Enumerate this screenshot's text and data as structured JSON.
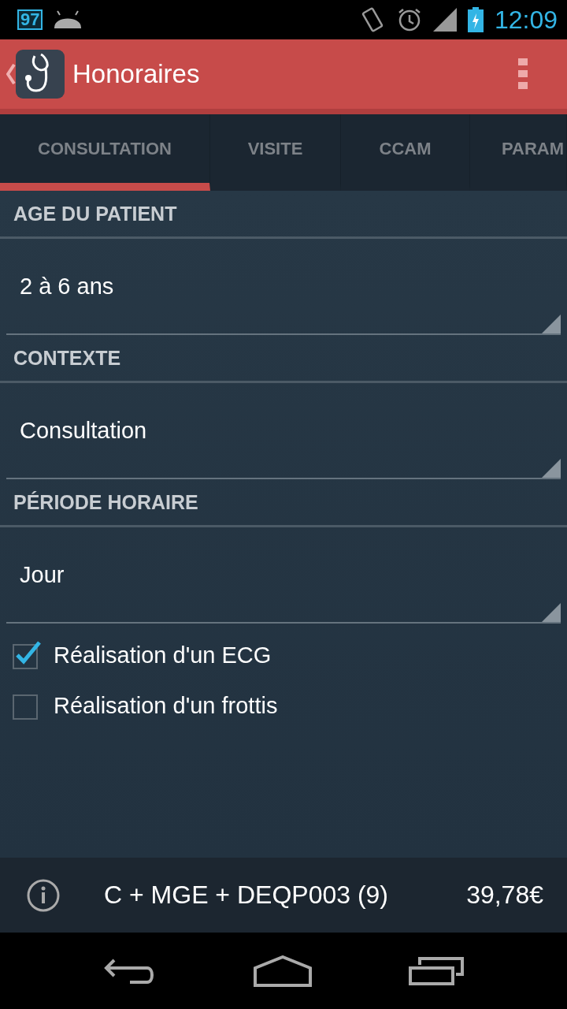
{
  "status_bar": {
    "badge": "97",
    "time": "12:09"
  },
  "action_bar": {
    "title": "Honoraires"
  },
  "tabs": [
    {
      "label": "CONSULTATION",
      "selected": true
    },
    {
      "label": "VISITE",
      "selected": false
    },
    {
      "label": "CCAM",
      "selected": false
    },
    {
      "label": "PARAM",
      "selected": false
    }
  ],
  "sections": [
    {
      "header": "AGE DU PATIENT",
      "value": "2 à 6 ans"
    },
    {
      "header": "CONTEXTE",
      "value": "Consultation"
    },
    {
      "header": "PÉRIODE HORAIRE",
      "value": "Jour"
    }
  ],
  "checkboxes": [
    {
      "label": "Réalisation d'un ECG",
      "checked": true
    },
    {
      "label": "Réalisation d'un frottis",
      "checked": false
    }
  ],
  "footer": {
    "code": "C + MGE + DEQP003 (9)",
    "amount": "39,78€"
  }
}
